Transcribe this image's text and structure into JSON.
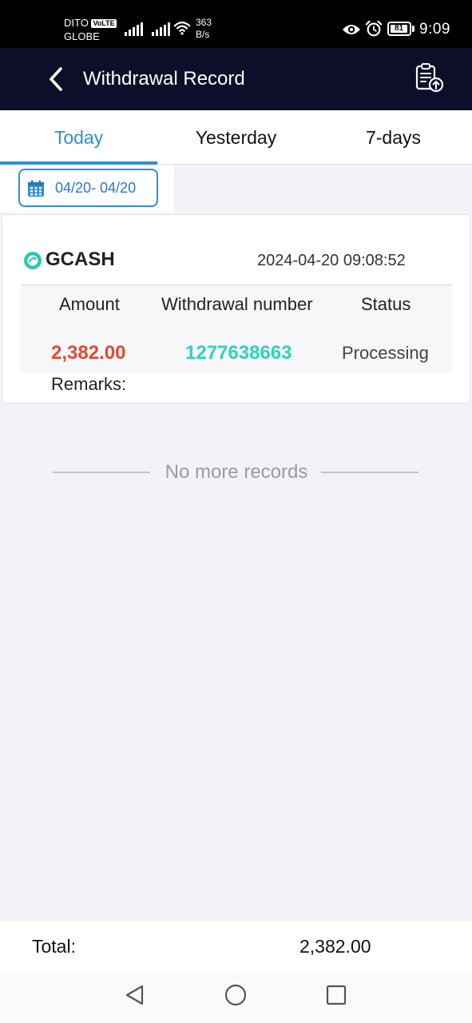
{
  "status_bar": {
    "carrier_1": "DITO",
    "volte": "VoLTE",
    "carrier_2": "GLOBE",
    "net_speed_value": "363",
    "net_speed_unit": "B/s",
    "battery": "81",
    "time": "9:09"
  },
  "header": {
    "back_icon": "chevron-left-icon",
    "title": "Withdrawal Record",
    "action_icon": "clipboard-upload-icon"
  },
  "tabs": [
    {
      "label": "Today",
      "active": true
    },
    {
      "label": "Yesterday",
      "active": false
    },
    {
      "label": "7-days",
      "active": false
    }
  ],
  "date_filter": {
    "icon": "calendar-icon",
    "range": "04/20- 04/20"
  },
  "record": {
    "method": "GCASH",
    "datetime": "2024-04-20 09:08:52",
    "columns": {
      "amount": "Amount",
      "number": "Withdrawal number",
      "status": "Status"
    },
    "amount": "2,382.00",
    "number": "1277638663",
    "status": "Processing",
    "remarks_label": "Remarks:"
  },
  "list_end": "No more records",
  "footer": {
    "total_label": "Total:",
    "total_value": "2,382.00"
  },
  "colors": {
    "accent": "#2f8fd6",
    "header_bg": "#0d0f2a",
    "amount": "#e24a2f",
    "number": "#2ed4b8"
  }
}
